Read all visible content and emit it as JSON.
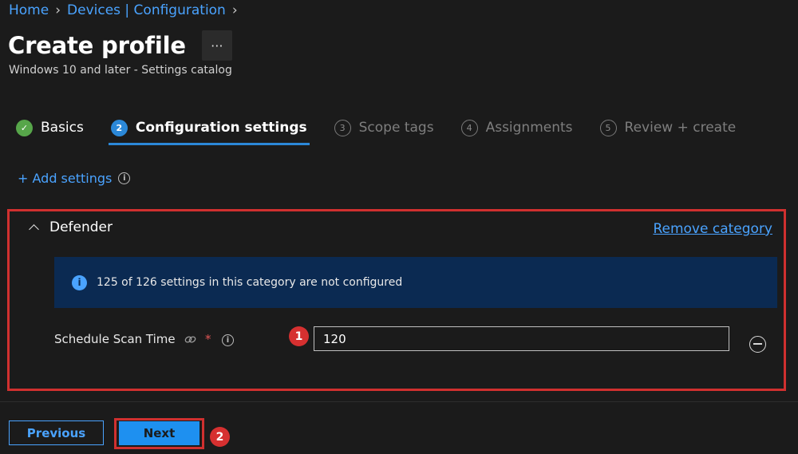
{
  "breadcrumb": {
    "items": [
      "Home",
      "Devices | Configuration"
    ]
  },
  "header": {
    "title": "Create profile",
    "more_label": "···",
    "subtitle": "Windows 10 and later - Settings catalog"
  },
  "steps": [
    {
      "number": "✓",
      "label": "Basics",
      "state": "done"
    },
    {
      "number": "2",
      "label": "Configuration settings",
      "state": "active"
    },
    {
      "number": "3",
      "label": "Scope tags",
      "state": "pending"
    },
    {
      "number": "4",
      "label": "Assignments",
      "state": "pending"
    },
    {
      "number": "5",
      "label": "Review + create",
      "state": "pending"
    }
  ],
  "add_settings": {
    "label": "+ Add settings"
  },
  "category": {
    "name": "Defender",
    "remove_label": "Remove category",
    "banner_text": "125 of 126 settings in this category are not configured",
    "setting": {
      "label": "Schedule Scan Time",
      "required_marker": "*",
      "value": "120"
    }
  },
  "annotations": {
    "badge_1": "1",
    "badge_2": "2"
  },
  "footer": {
    "previous_label": "Previous",
    "next_label": "Next"
  },
  "colors": {
    "accent": "#4aa3ff",
    "highlight": "#d0302f",
    "banner": "#0b2a52",
    "success": "#57a64a"
  }
}
